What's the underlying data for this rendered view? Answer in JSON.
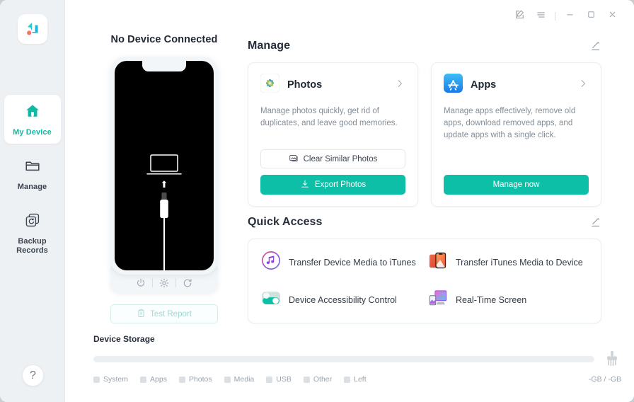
{
  "app": {
    "logo_alt": "logo"
  },
  "titlebar": {
    "buttons": [
      {
        "name": "feedback",
        "label": "Feedback"
      },
      {
        "name": "menu",
        "label": "Menu"
      },
      {
        "name": "minimize",
        "label": "Minimize"
      },
      {
        "name": "maximize",
        "label": "Maximize"
      },
      {
        "name": "close",
        "label": "Close"
      }
    ]
  },
  "sidebar": {
    "items": [
      {
        "label": "My Device",
        "icon": "home-icon",
        "active": true
      },
      {
        "label": "Manage",
        "icon": "folder-icon",
        "active": false
      },
      {
        "label": "Backup\nRecords",
        "icon": "backup-icon",
        "active": false
      }
    ],
    "item_labels": {
      "my_device": "My Device",
      "manage": "Manage",
      "backup_line1": "Backup",
      "backup_line2": "Records"
    },
    "help_label": "?"
  },
  "device": {
    "status": "No Device Connected",
    "controls": [
      {
        "name": "power-icon",
        "label": "Power"
      },
      {
        "name": "brightness-icon",
        "label": "Brightness"
      },
      {
        "name": "refresh-icon",
        "label": "Refresh"
      }
    ],
    "test_report_label": "Test Report"
  },
  "manage": {
    "title": "Manage",
    "edit_label": "Edit",
    "cards": [
      {
        "title": "Photos",
        "icon": "photos-icon",
        "description": "Manage photos quickly, get rid of duplicates, and leave good memories.",
        "secondary_button": "Clear Similar Photos",
        "primary_button": "Export Photos"
      },
      {
        "title": "Apps",
        "icon": "app-store-icon",
        "description": "Manage apps effectively, remove old apps, download removed apps, and update apps with a single click.",
        "primary_button": "Manage now"
      }
    ]
  },
  "quick_access": {
    "title": "Quick Access",
    "edit_label": "Edit",
    "items": [
      {
        "label": "Transfer Device Media to iTunes",
        "icon": "itunes-icon"
      },
      {
        "label": "Transfer iTunes Media to Device",
        "icon": "phone-media-icon"
      },
      {
        "label": "Device Accessibility Control",
        "icon": "toggle-icon"
      },
      {
        "label": "Real-Time Screen",
        "icon": "screen-mirror-icon"
      }
    ]
  },
  "storage": {
    "title": "Device Storage",
    "value": "-GB / -GB",
    "clean_icon": "broom-icon",
    "legend": [
      {
        "label": "System",
        "color": "#dcdfe3"
      },
      {
        "label": "Apps",
        "color": "#dcdfe3"
      },
      {
        "label": "Photos",
        "color": "#dcdfe3"
      },
      {
        "label": "Media",
        "color": "#dcdfe3"
      },
      {
        "label": "USB",
        "color": "#e2e5e9"
      },
      {
        "label": "Other",
        "color": "#dcdfe3"
      },
      {
        "label": "Left",
        "color": "#dcdfe3"
      }
    ]
  },
  "colors": {
    "accent": "#0cbfa6",
    "sidebar_bg": "#eef1f4",
    "text_primary": "#1f2733",
    "text_muted": "#838d97"
  }
}
